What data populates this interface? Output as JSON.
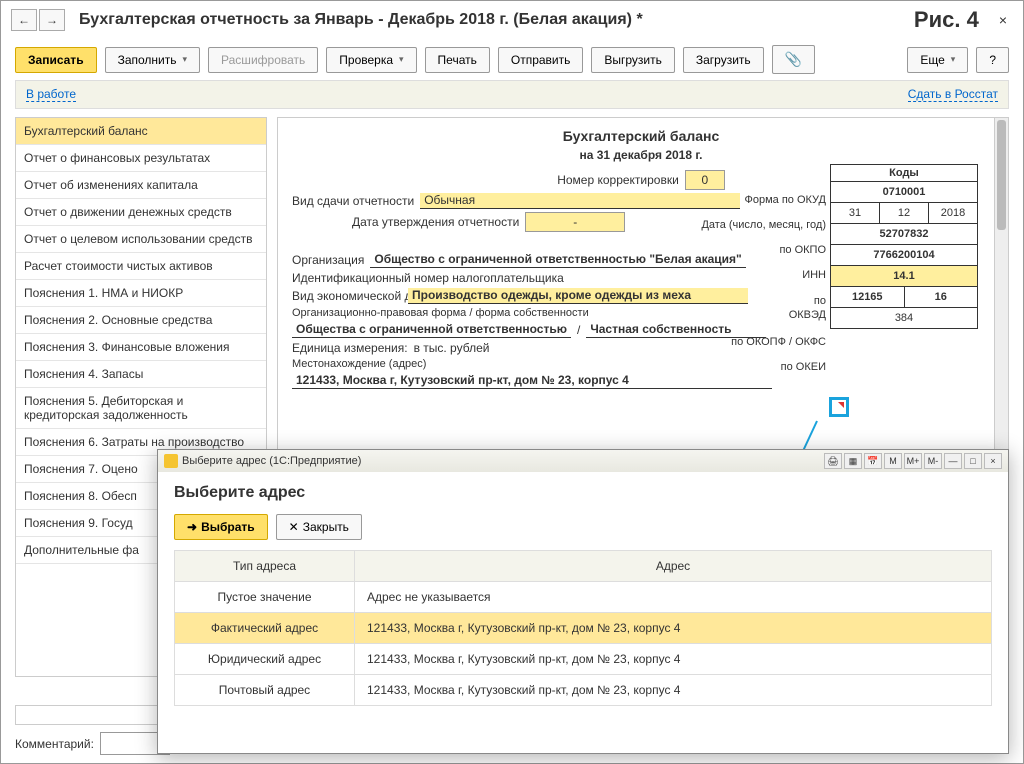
{
  "header": {
    "title": "Бухгалтерская отчетность за Январь - Декабрь 2018 г. (Белая акация) *",
    "figure": "Рис. 4"
  },
  "toolbar": {
    "save": "Записать",
    "fill": "Заполнить",
    "decode": "Расшифровать",
    "check": "Проверка",
    "print": "Печать",
    "send": "Отправить",
    "export": "Выгрузить",
    "import": "Загрузить",
    "more": "Еще",
    "help": "?"
  },
  "status": {
    "label": "В работе",
    "link": "Сдать в Росстат"
  },
  "sidebar": {
    "items": [
      "Бухгалтерский баланс",
      "Отчет о финансовых результатах",
      "Отчет об изменениях капитала",
      "Отчет о движении денежных средств",
      "Отчет о целевом использовании средств",
      "Расчет стоимости чистых активов",
      "Пояснения 1. НМА и НИОКР",
      "Пояснения 2. Основные средства",
      "Пояснения 3. Финансовые вложения",
      "Пояснения 4. Запасы",
      "Пояснения 5. Дебиторская и кредиторская задолженность",
      "Пояснения 6. Затраты на производство",
      "Пояснения 7. Оцено",
      "Пояснения 8. Обесп",
      "Пояснения 9. Госуд",
      "Дополнительные фа"
    ]
  },
  "doc": {
    "title": "Бухгалтерский баланс",
    "date": "на 31 декабря 2018 г.",
    "corr_lbl": "Номер корректировки",
    "corr": "0",
    "type_lbl": "Вид сдачи отчетности",
    "type": "Обычная",
    "appr_lbl": "Дата утверждения отчетности",
    "appr": "-",
    "org_lbl": "Организация",
    "org": "Общество с ограниченной ответственностью \"Белая акация\"",
    "inn_lbl": "Идентификационный номер налогоплательщика",
    "act_lbl": "Вид экономической деятельности",
    "act": "Производство одежды, кроме одежды из меха",
    "form_lbl": "Организационно-правовая форма / форма собственности",
    "form1": "Общества с ограниченной ответственностью",
    "form2": "Частная собственность",
    "unit_lbl": "Единица измерения:",
    "unit": "в тыс. рублей",
    "addr_lbl": "Местонахождение (адрес)",
    "addr": "121433, Москва г, Кутузовский пр-кт, дом № 23, корпус 4"
  },
  "codes": {
    "header": "Коды",
    "labels": {
      "okud": "Форма по ОКУД",
      "date": "Дата (число, месяц, год)",
      "okpo": "по ОКПО",
      "inn": "ИНН",
      "okved": "по ОКВЭД",
      "okopf": "по ОКОПФ / ОКФС",
      "okei": "по ОКЕИ"
    },
    "okud": "0710001",
    "d": "31",
    "m": "12",
    "y": "2018",
    "okpo": "52707832",
    "inn": "7766200104",
    "okved": "14.1",
    "okopf": "12165",
    "okfs": "16",
    "okei": "384"
  },
  "dialog": {
    "wintitle": "Выберите адрес  (1С:Предприятие)",
    "title": "Выберите адрес",
    "select": "Выбрать",
    "close": "Закрыть",
    "th1": "Тип адреса",
    "th2": "Адрес",
    "rows": [
      {
        "t": "Пустое значение",
        "a": "Адрес не указывается"
      },
      {
        "t": "Фактический адрес",
        "a": "121433, Москва г, Кутузовский пр-кт, дом № 23, корпус 4"
      },
      {
        "t": "Юридический адрес",
        "a": "121433, Москва г, Кутузовский пр-кт, дом № 23, корпус 4"
      },
      {
        "t": "Почтовый адрес",
        "a": "121433, Москва г, Кутузовский пр-кт, дом № 23, корпус 4"
      }
    ],
    "mini": [
      "M",
      "M+",
      "M-"
    ]
  },
  "comment": "Комментарий:"
}
